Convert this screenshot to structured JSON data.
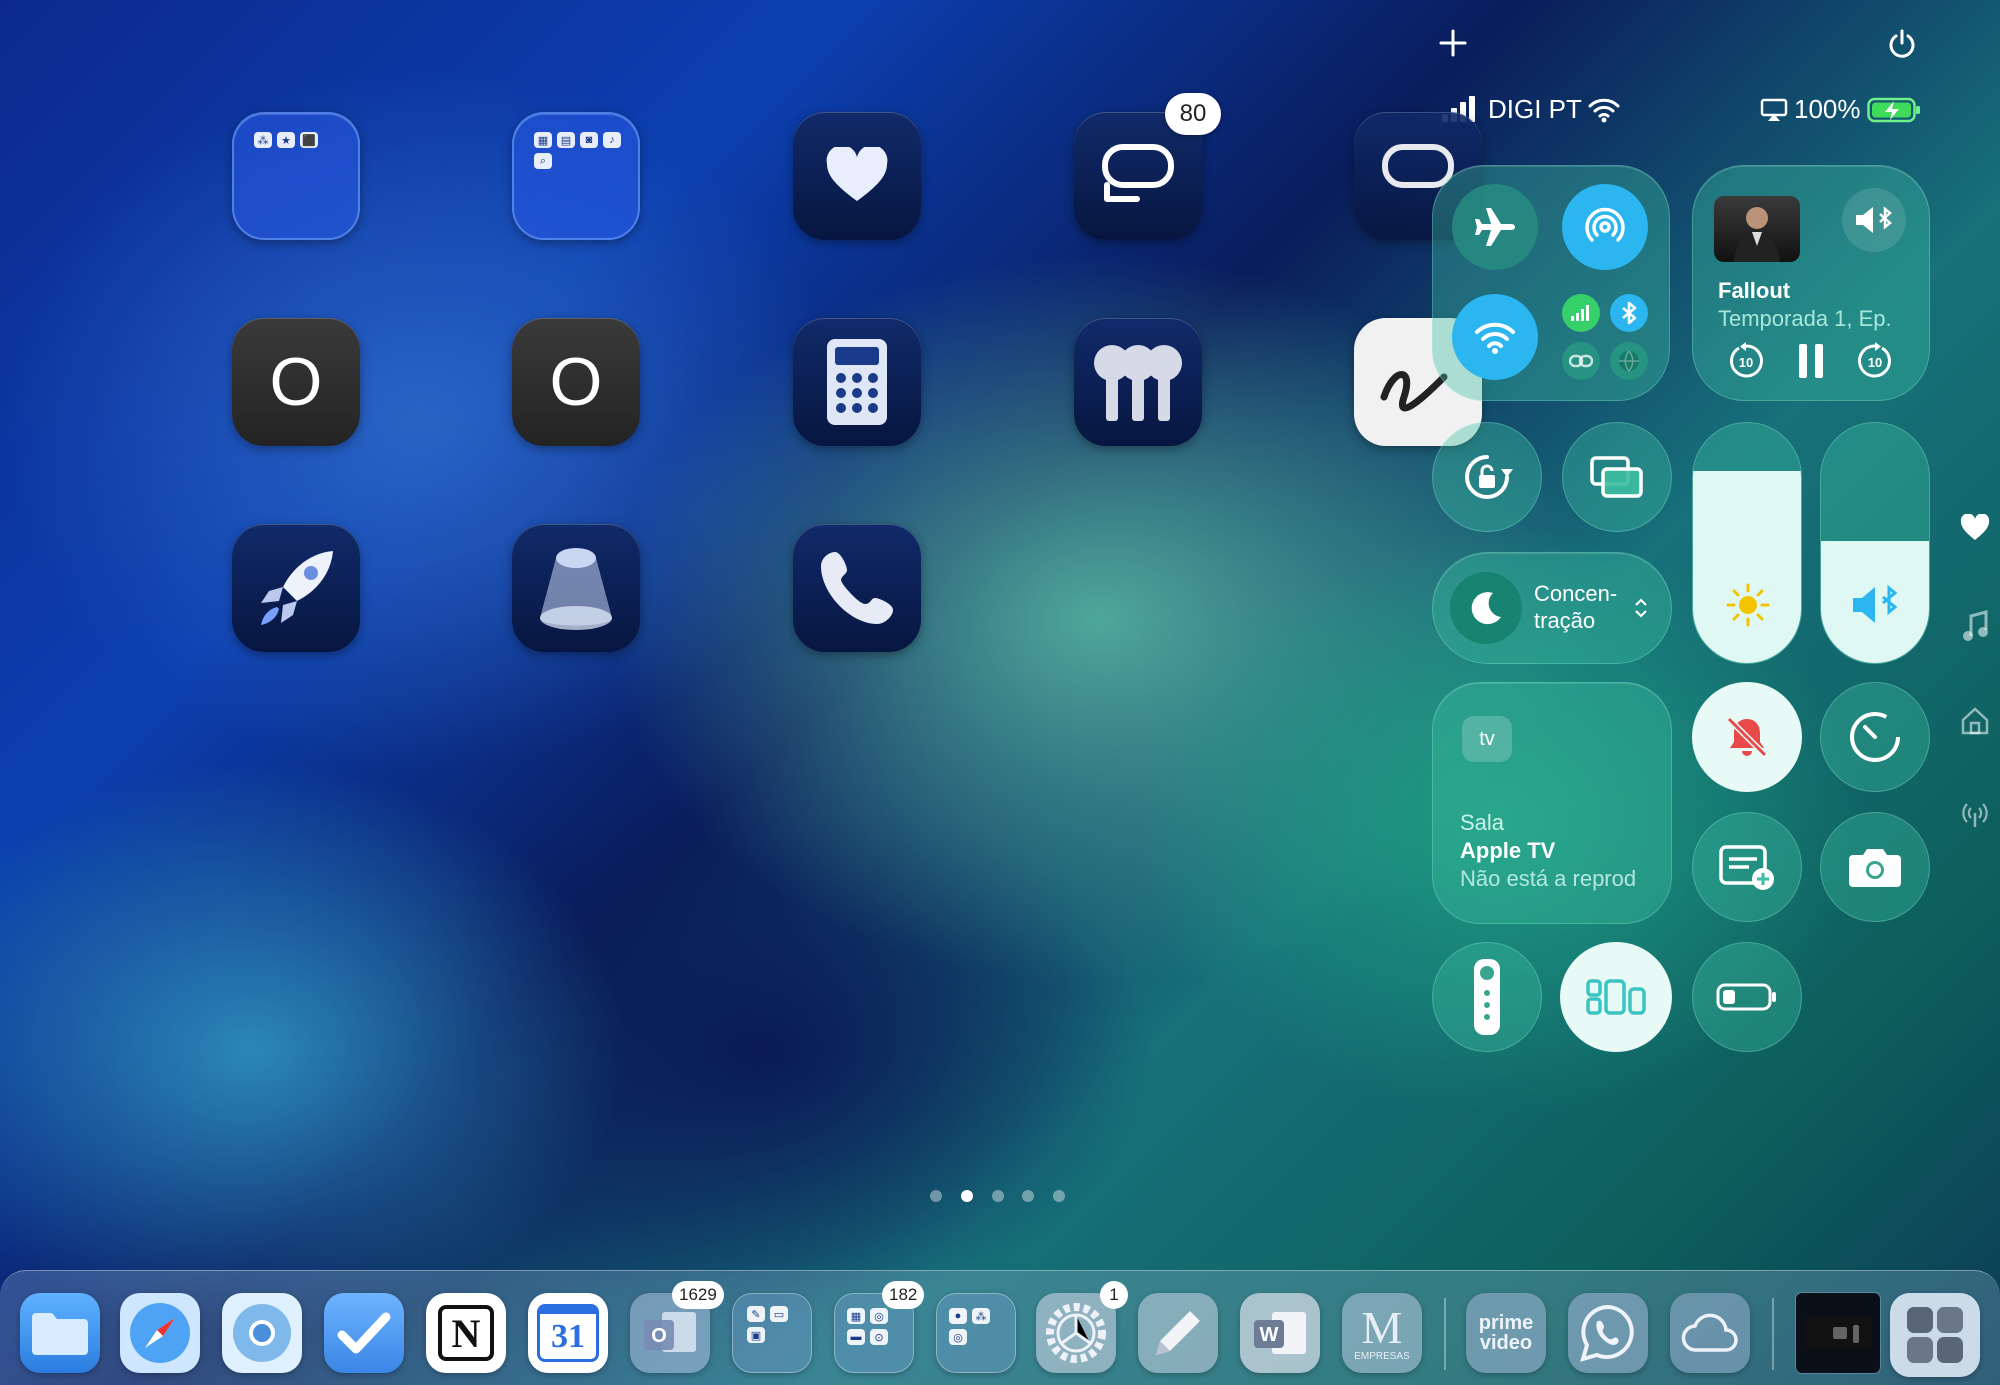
{
  "status_bar": {
    "carrier": "DIGI PT",
    "battery": "100%"
  },
  "top_controls": {
    "add_icon": "plus-icon",
    "power_icon": "power-icon"
  },
  "home": {
    "badge_80": "80",
    "o_label": "O"
  },
  "media": {
    "title": "Fallout",
    "subtitle": "Temporada 1, Ep."
  },
  "focus": {
    "label_line1": "Concen-",
    "label_line2": "tração"
  },
  "apple_tv": {
    "logo": "tv",
    "room": "Sala",
    "device": "Apple TV",
    "status": "Não está a reprod"
  },
  "dock": {
    "badge_outlook": "1629",
    "badge_folder": "182",
    "badge_settings": "1",
    "notion": "N",
    "calendar": "31",
    "prime_line1": "prime",
    "prime_line2": "video",
    "mercadona": "M",
    "mercadona_sub": "EMPRESAS",
    "word": "W"
  },
  "page_dots": {
    "count": 5,
    "active": 1
  },
  "colors": {
    "accent": "#2bb6f0",
    "cc_glass": "#3cbea0",
    "dnd_red": "#e84a4a"
  }
}
